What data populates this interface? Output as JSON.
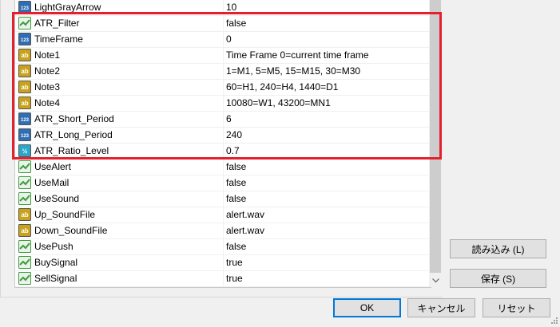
{
  "parameters": [
    {
      "name": "LightGrayArrow",
      "value": "10",
      "type": "int"
    },
    {
      "name": "ATR_Filter",
      "value": "false",
      "type": "bool"
    },
    {
      "name": "TimeFrame",
      "value": "0",
      "type": "int"
    },
    {
      "name": "Note1",
      "value": "Time Frame 0=current time frame",
      "type": "string"
    },
    {
      "name": "Note2",
      "value": "1=M1, 5=M5, 15=M15, 30=M30",
      "type": "string"
    },
    {
      "name": "Note3",
      "value": "60=H1, 240=H4, 1440=D1",
      "type": "string"
    },
    {
      "name": "Note4",
      "value": "10080=W1, 43200=MN1",
      "type": "string"
    },
    {
      "name": "ATR_Short_Period",
      "value": "6",
      "type": "int"
    },
    {
      "name": "ATR_Long_Period",
      "value": "240",
      "type": "int"
    },
    {
      "name": "ATR_Ratio_Level",
      "value": "0.7",
      "type": "double"
    },
    {
      "name": "UseAlert",
      "value": "false",
      "type": "bool"
    },
    {
      "name": "UseMail",
      "value": "false",
      "type": "bool"
    },
    {
      "name": "UseSound",
      "value": "false",
      "type": "bool"
    },
    {
      "name": "Up_SoundFile",
      "value": "alert.wav",
      "type": "string"
    },
    {
      "name": "Down_SoundFile",
      "value": "alert.wav",
      "type": "string"
    },
    {
      "name": "UsePush",
      "value": "false",
      "type": "bool"
    },
    {
      "name": "BuySignal",
      "value": "true",
      "type": "bool"
    },
    {
      "name": "SellSignal",
      "value": "true",
      "type": "bool"
    }
  ],
  "icons": {
    "int": {
      "label": "123",
      "bg": "#2f6db5"
    },
    "bool": {
      "label": "",
      "bg": "#3f9a3f"
    },
    "string": {
      "label": "ab",
      "bg": "#c9a21a"
    },
    "double": {
      "label": "½",
      "bg": "#2aa7c8"
    }
  },
  "buttons": {
    "load": "読み込み (L)",
    "save": "保存 (S)",
    "ok": "OK",
    "cancel": "キャンセル",
    "reset": "リセット"
  },
  "colors": {
    "highlight": "#e4202e",
    "accent": "#0078d7"
  }
}
